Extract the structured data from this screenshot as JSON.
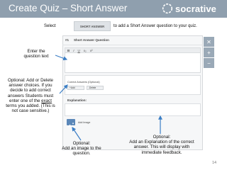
{
  "header": {
    "title": "Create Quiz – Short Answer",
    "logo_text": "socrative",
    "background": "#8f9fae"
  },
  "instruction": {
    "prefix": "Select",
    "button_label": "SHORT ANSWER",
    "suffix": "to add a Short Answer question to your quiz."
  },
  "quiz": {
    "question_number": "#1",
    "question_type": "Short Answer Question",
    "toolbar": [
      "B",
      "I",
      "U",
      "x₂",
      "x²"
    ],
    "correct_answers_label": "Correct Answers (Optional)",
    "add_label": "+Add",
    "delete_label": "-Delete",
    "explanation_label": "Explanation:",
    "add_image_label": "Add Image"
  },
  "side_actions": [
    "✕",
    "+",
    "−"
  ],
  "callouts": {
    "question_text": [
      "Enter the",
      "question text"
    ],
    "answers": [
      "Optional: Add or Delete",
      "answer choices. If you",
      "decide to add correct",
      "answers Students must",
      "enter one of the",
      "exact",
      "terms you added. (This is",
      "not case sensitive.)"
    ],
    "image": [
      "Optional:",
      "Add an image to the",
      "question."
    ],
    "explanation": [
      "Optional:",
      "Add an Explanation of the correct",
      "answer. This will display with",
      "immediate feedback."
    ]
  },
  "page_number": "14",
  "accent_color": "#3b7ec5"
}
